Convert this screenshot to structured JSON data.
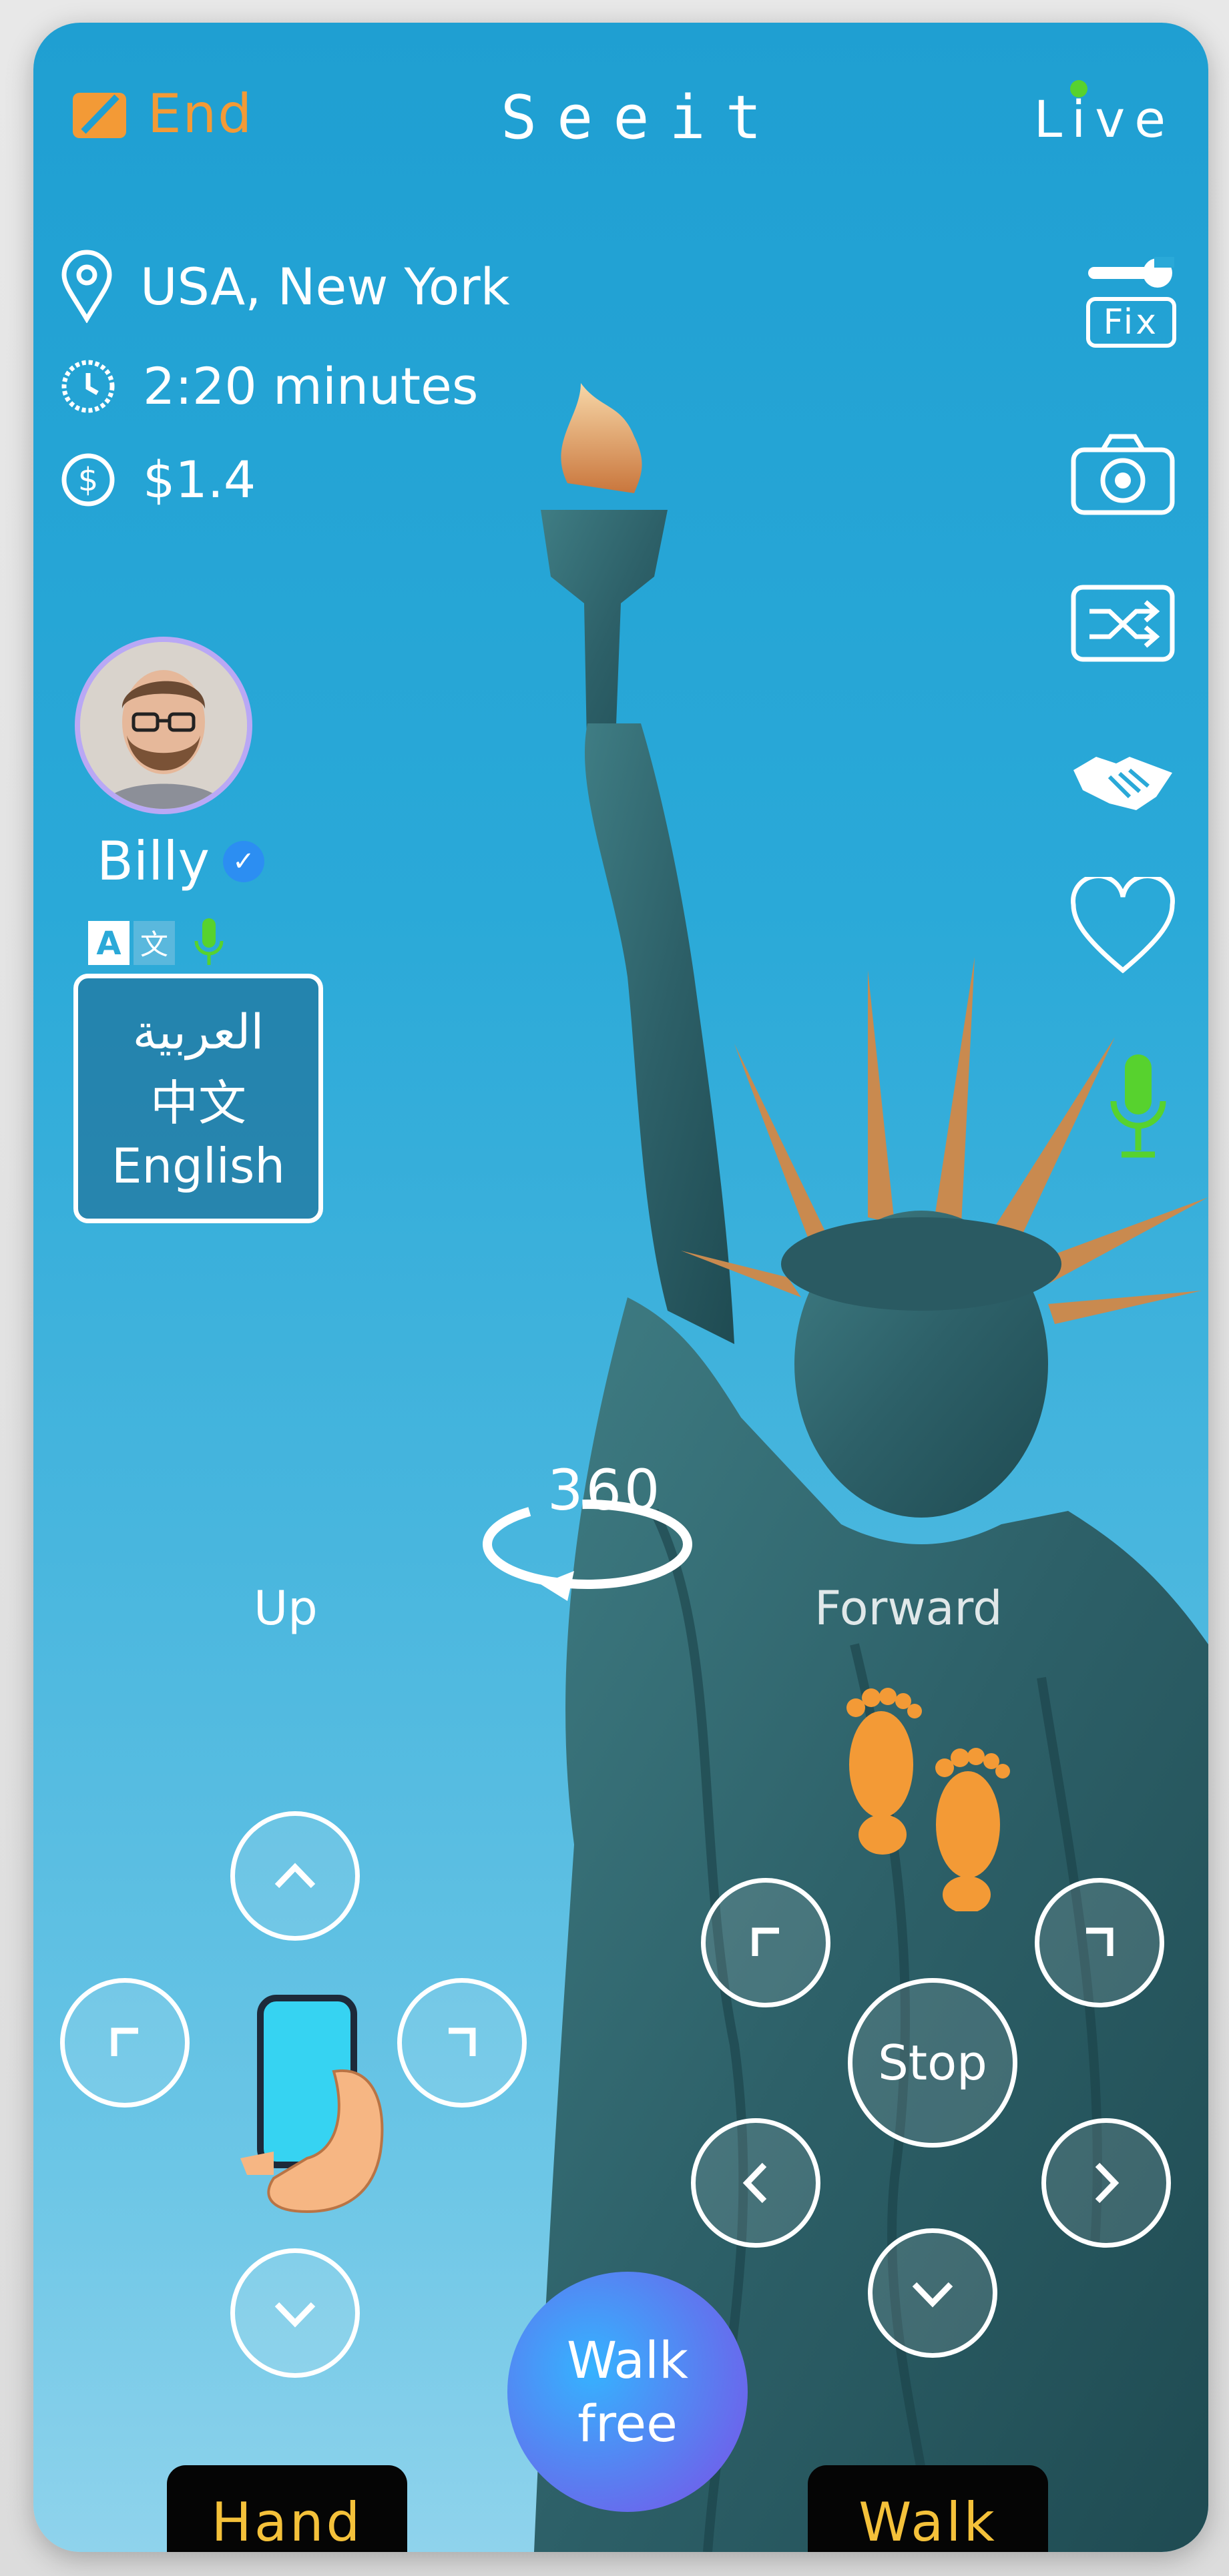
{
  "header": {
    "end_label": "End",
    "brand": "Seeit",
    "live_label": "Live"
  },
  "info": {
    "location": "USA, New York",
    "duration": "2:20 minutes",
    "price": "$1.4"
  },
  "right_toolbar": {
    "fix_label": "Fix"
  },
  "guide": {
    "name": "Billy"
  },
  "languages": {
    "items": [
      "العربية",
      "中文",
      "English"
    ]
  },
  "controls": {
    "rotate_label": "360",
    "up_label": "Up",
    "forward_label": "Forward",
    "stop_label": "Stop",
    "walk_free_line1": "Walk",
    "walk_free_line2": "free"
  },
  "bottom_tabs": {
    "hand_label": "Hand",
    "walk_label": "Walk"
  },
  "colors": {
    "accent_orange": "#f39a36",
    "live_green": "#57d22e",
    "tab_text": "#f4c13a"
  }
}
